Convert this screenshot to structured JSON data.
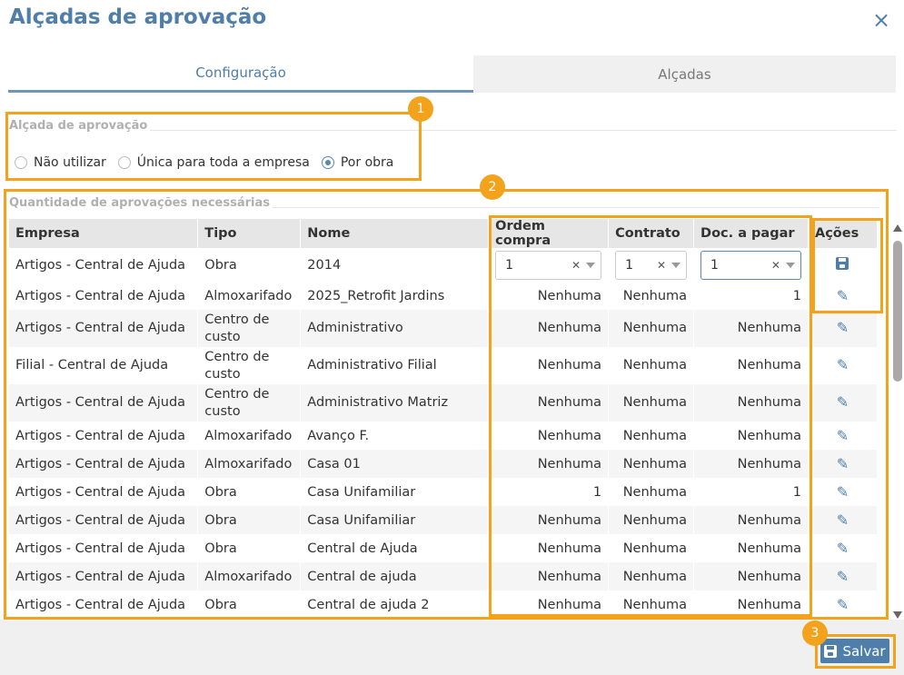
{
  "dialog": {
    "title": "Alçadas de aprovação",
    "close_icon": "×"
  },
  "tabs": [
    {
      "label": "Configuração",
      "active": true
    },
    {
      "label": "Alçadas",
      "active": false
    }
  ],
  "approval_level": {
    "legend": "Alçada de aprovação",
    "options": [
      {
        "label": "Não utilizar",
        "selected": false
      },
      {
        "label": "Única para toda a empresa",
        "selected": false
      },
      {
        "label": "Por obra",
        "selected": true
      }
    ]
  },
  "approvals_qty": {
    "legend": "Quantidade de aprovações necessárias",
    "columns": [
      "Empresa",
      "Tipo",
      "Nome",
      "Ordem compra",
      "Contrato",
      "Doc. a pagar",
      "Ações"
    ],
    "edit_row": {
      "empresa": "Artigos - Central de Ajuda",
      "tipo": "Obra",
      "nome": "2014",
      "ordem": "1",
      "contrato": "1",
      "doc": "1"
    },
    "rows": [
      {
        "empresa": "Artigos - Central de Ajuda",
        "tipo": "Almoxarifado",
        "nome": "2025_Retrofit Jardins",
        "ordem": "Nenhuma",
        "contrato": "Nenhuma",
        "doc": "1"
      },
      {
        "empresa": "Artigos - Central de Ajuda",
        "tipo": "Centro de custo",
        "nome": "Administrativo",
        "ordem": "Nenhuma",
        "contrato": "Nenhuma",
        "doc": "Nenhuma"
      },
      {
        "empresa": "Filial - Central de Ajuda",
        "tipo": "Centro de custo",
        "nome": "Administrativo Filial",
        "ordem": "Nenhuma",
        "contrato": "Nenhuma",
        "doc": "Nenhuma"
      },
      {
        "empresa": "Artigos - Central de Ajuda",
        "tipo": "Centro de custo",
        "nome": "Administrativo Matriz",
        "ordem": "Nenhuma",
        "contrato": "Nenhuma",
        "doc": "Nenhuma"
      },
      {
        "empresa": "Artigos - Central de Ajuda",
        "tipo": "Almoxarifado",
        "nome": "Avanço F.",
        "ordem": "Nenhuma",
        "contrato": "Nenhuma",
        "doc": "Nenhuma"
      },
      {
        "empresa": "Artigos - Central de Ajuda",
        "tipo": "Almoxarifado",
        "nome": "Casa 01",
        "ordem": "Nenhuma",
        "contrato": "Nenhuma",
        "doc": "Nenhuma"
      },
      {
        "empresa": "Artigos - Central de Ajuda",
        "tipo": "Obra",
        "nome": "Casa Unifamiliar",
        "ordem": "1",
        "contrato": "Nenhuma",
        "doc": "1"
      },
      {
        "empresa": "Artigos - Central de Ajuda",
        "tipo": "Obra",
        "nome": "Casa Unifamiliar",
        "ordem": "Nenhuma",
        "contrato": "Nenhuma",
        "doc": "Nenhuma"
      },
      {
        "empresa": "Artigos - Central de Ajuda",
        "tipo": "Obra",
        "nome": "Central de Ajuda",
        "ordem": "Nenhuma",
        "contrato": "Nenhuma",
        "doc": "Nenhuma"
      },
      {
        "empresa": "Artigos - Central de Ajuda",
        "tipo": "Almoxarifado",
        "nome": "Central de ajuda",
        "ordem": "Nenhuma",
        "contrato": "Nenhuma",
        "doc": "Nenhuma"
      },
      {
        "empresa": "Artigos - Central de Ajuda",
        "tipo": "Obra",
        "nome": "Central de ajuda 2",
        "ordem": "Nenhuma",
        "contrato": "Nenhuma",
        "doc": "Nenhuma"
      }
    ]
  },
  "footer": {
    "save_label": "Salvar"
  },
  "callouts": [
    "1",
    "2",
    "3"
  ],
  "colors": {
    "accent": "#4e7ea9",
    "highlight": "#f3a31b"
  }
}
